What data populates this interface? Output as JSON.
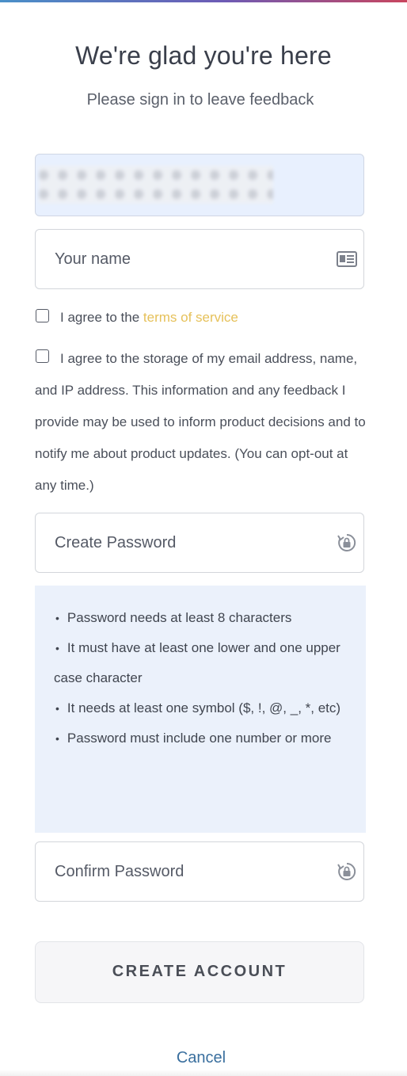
{
  "header": {
    "title": "We're glad you're here",
    "subtitle": "Please sign in to leave feedback"
  },
  "form": {
    "email": {
      "value": ""
    },
    "name": {
      "placeholder": "Your name",
      "icon": "contact-card-icon"
    },
    "terms": {
      "prefix": "I agree to the ",
      "link": "terms of service"
    },
    "consent": {
      "text": "I agree to the storage of my email address, name, and IP address. This information and any feedback I provide may be used to inform product decisions and to notify me about product updates. (You can opt-out at any time.)"
    },
    "password": {
      "placeholder": "Create Password",
      "icon": "lock-refresh-icon"
    },
    "password_rules": [
      "Password needs at least 8 characters",
      "It must have at least one lower and one upper case character",
      "It needs at least one symbol ($, !, @, _, *, etc)",
      "Password must include one number or more"
    ],
    "confirm_password": {
      "placeholder": "Confirm Password",
      "icon": "lock-refresh-icon"
    },
    "submit_label": "CREATE ACCOUNT",
    "cancel_label": "Cancel"
  },
  "colors": {
    "link": "#e6c15a",
    "cancel": "#3a6f9e",
    "autofill": "#e8f0fe",
    "rules_bg": "#ebf1fb"
  }
}
